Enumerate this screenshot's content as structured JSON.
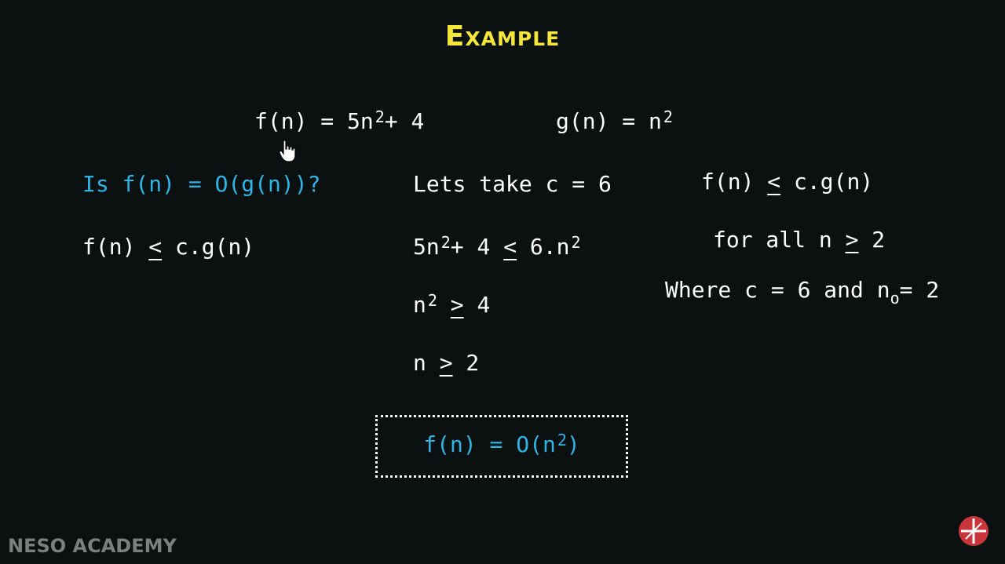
{
  "title": "Example",
  "f_def": {
    "lhs": "f(n) = 5n",
    "exp": "2",
    "rhs": "+ 4"
  },
  "g_def": {
    "lhs": "g(n) = n",
    "exp": "2"
  },
  "question": "Is f(n) = O(g(n))?",
  "left_ineq": {
    "a": "f(n) ",
    "op": "<",
    "b": " c.g(n)"
  },
  "take_c": "Lets take c = 6",
  "step1": {
    "a": "5n",
    "exp1": "2",
    "b": "+ 4 ",
    "op": "<",
    "c": " 6.n",
    "exp2": "2"
  },
  "step2": {
    "a": "n",
    "exp": "2",
    "op": ">",
    "b": " 4"
  },
  "step3": {
    "a": "n ",
    "op": ">",
    "b": " 2"
  },
  "right_ineq": {
    "a": "f(n) ",
    "op": "<",
    "b": " c.g(n)"
  },
  "for_all": {
    "a": "for all n ",
    "op": ">",
    "b": " 2"
  },
  "where": {
    "a": "Where c = 6 and n",
    "sub": "o",
    "b": "= 2"
  },
  "result": {
    "a": "f(n) = O(n",
    "exp": "2",
    "b": ")"
  },
  "watermark": "NESO ACADEMY",
  "icons": {
    "cursor": "hand-cursor-icon",
    "logo": "neso-logo-icon"
  },
  "colors": {
    "title": "#f5e63a",
    "accent": "#2fb4e6",
    "background": "#0b1111",
    "text": "#ffffff"
  }
}
